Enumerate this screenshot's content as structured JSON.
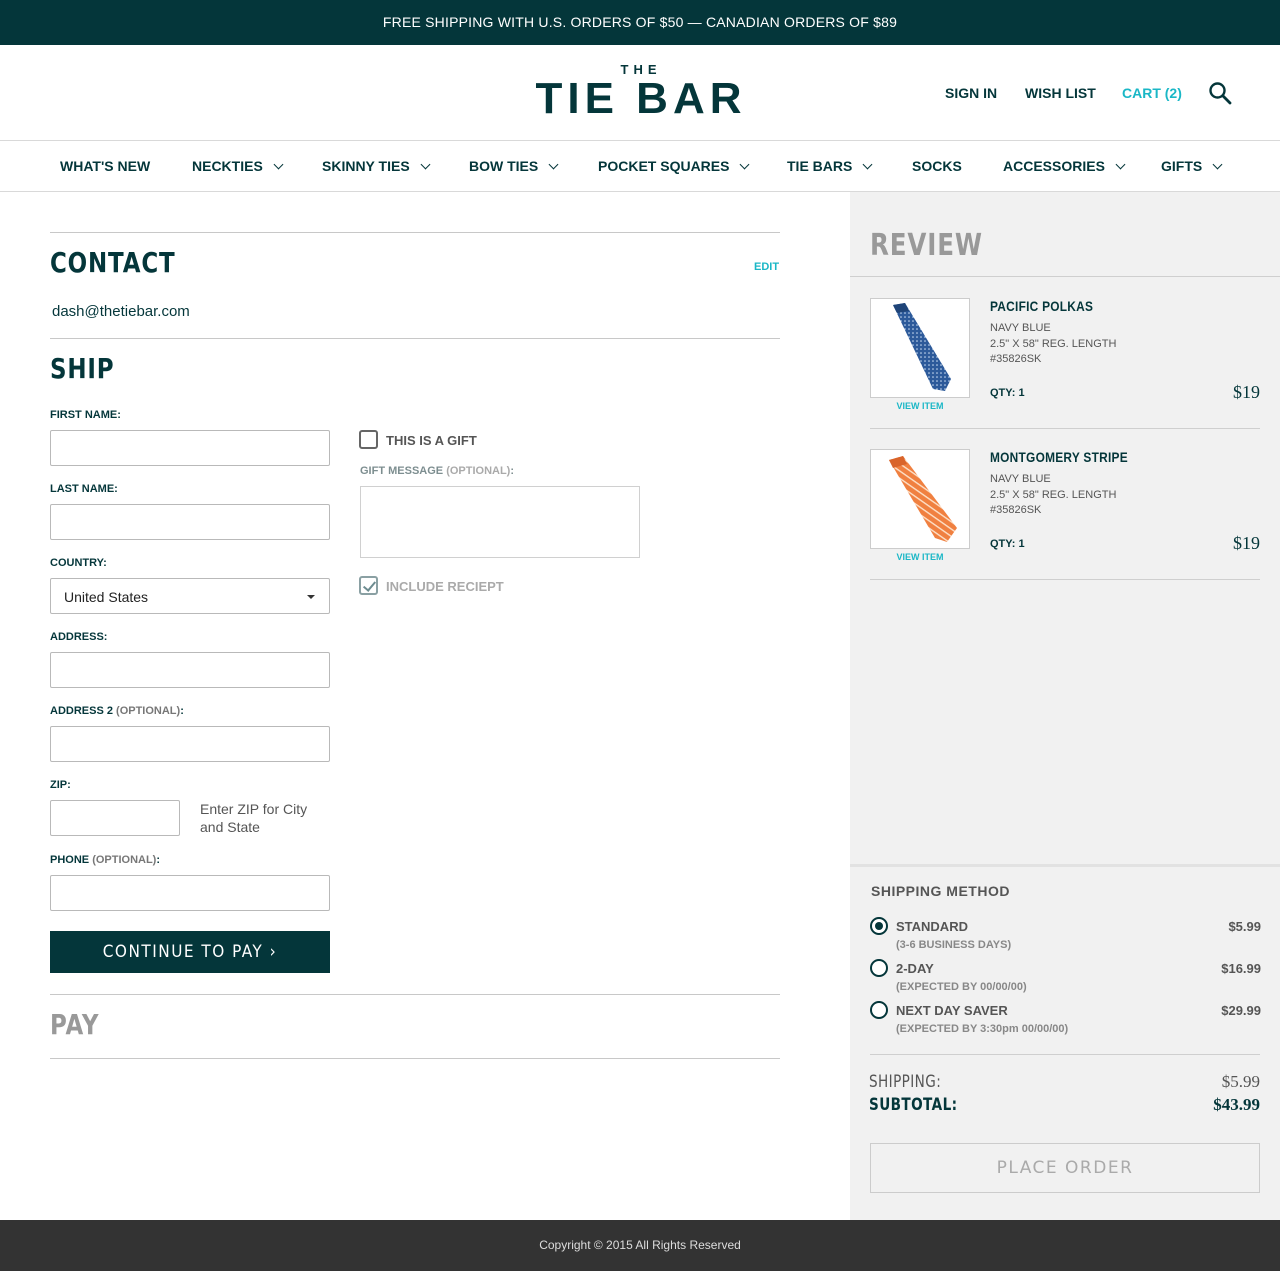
{
  "promo": "FREE SHIPPING WITH U.S. ORDERS OF $50 — CANADIAN ORDERS OF $89",
  "logo": {
    "top": "THE",
    "main": "TIE BAR"
  },
  "header": {
    "sign_in": "SIGN IN",
    "wish_list": "WISH LIST",
    "cart": "CART (2)",
    "search_icon": "search-icon"
  },
  "nav": [
    {
      "label": "WHAT'S NEW",
      "dropdown": false
    },
    {
      "label": "NECKTIES",
      "dropdown": true
    },
    {
      "label": "SKINNY TIES",
      "dropdown": true
    },
    {
      "label": "BOW TIES",
      "dropdown": true
    },
    {
      "label": "POCKET SQUARES",
      "dropdown": true
    },
    {
      "label": "TIE BARS",
      "dropdown": true
    },
    {
      "label": "SOCKS",
      "dropdown": false
    },
    {
      "label": "ACCESSORIES",
      "dropdown": true
    },
    {
      "label": "GIFTS",
      "dropdown": true
    }
  ],
  "contact": {
    "title": "CONTACT",
    "edit": "EDIT",
    "email": "dash@thetiebar.com"
  },
  "ship": {
    "title": "SHIP",
    "first_name": "FIRST NAME:",
    "last_name": "LAST NAME:",
    "country": "COUNTRY:",
    "country_value": "United States",
    "address": "ADDRESS:",
    "address2": "ADDRESS 2",
    "optional": "(OPTIONAL)",
    "colon": ":",
    "zip": "ZIP:",
    "zip_hint": "Enter ZIP for City and State",
    "phone": "PHONE",
    "gift_checkbox": "THIS IS A GIFT",
    "gift_message": "GIFT MESSAGE",
    "include_receipt": "INCLUDE RECIEPT",
    "continue": "CONTINUE TO PAY ›"
  },
  "pay": {
    "title": "PAY"
  },
  "review": {
    "title": "REVIEW",
    "items": [
      {
        "name": "PACIFIC POLKAS",
        "color": "NAVY BLUE",
        "size": "2.5\" X 58\" REG. LENGTH",
        "sku": "#35826SK",
        "qty": "QTY: 1",
        "price": "$19",
        "view": "VIEW ITEM",
        "tie_color": "#2d5a9a"
      },
      {
        "name": "MONTGOMERY STRIPE",
        "color": "NAVY BLUE",
        "size": "2.5\" X 58\" REG. LENGTH",
        "sku": "#35826SK",
        "qty": "QTY: 1",
        "price": "$19",
        "view": "VIEW ITEM",
        "tie_color": "#f08040"
      }
    ]
  },
  "shipping_method": {
    "title": "SHIPPING METHOD",
    "options": [
      {
        "name": "STANDARD",
        "sub": "(3-6 BUSINESS DAYS)",
        "price": "$5.99",
        "selected": true
      },
      {
        "name": "2-DAY",
        "sub": "(EXPECTED BY 00/00/00)",
        "price": "$16.99",
        "selected": false
      },
      {
        "name": "NEXT DAY SAVER",
        "sub": "(EXPECTED BY 3:30pm 00/00/00)",
        "price": "$29.99",
        "selected": false
      }
    ]
  },
  "totals": {
    "shipping_label": "SHIPPING:",
    "shipping_value": "$5.99",
    "subtotal_label": "SUBTOTAL:",
    "subtotal_value": "$43.99"
  },
  "place_order": "PLACE ORDER",
  "footer": "Copyright © 2015 All Rights Reserved",
  "colors": {
    "brand": "#04363a",
    "accent": "#1ab7c6",
    "panel": "#f1f1f1",
    "footer": "#333333"
  }
}
